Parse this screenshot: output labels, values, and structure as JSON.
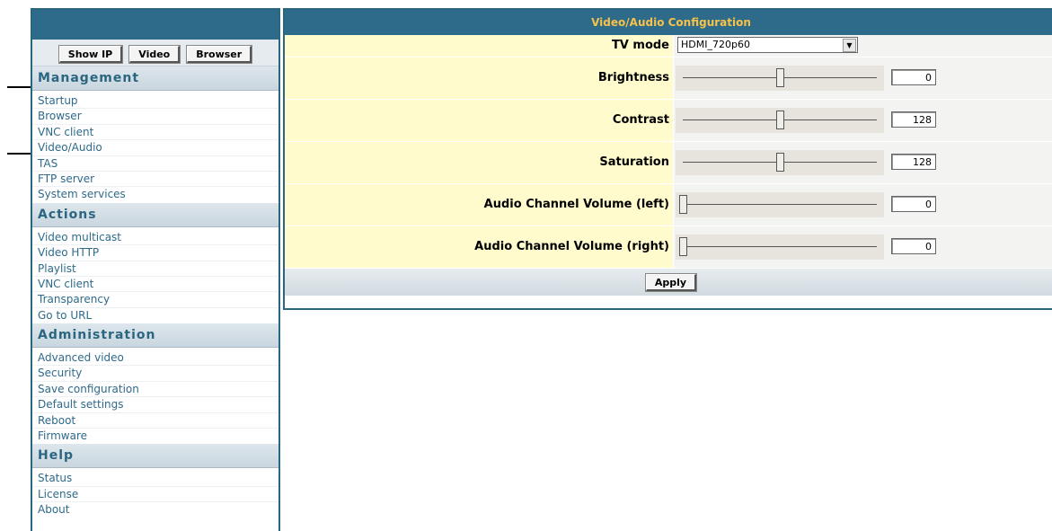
{
  "sidebar": {
    "buttons": [
      "Show IP",
      "Video",
      "Browser"
    ],
    "sections": [
      {
        "title": "Management",
        "items": [
          "Startup",
          "Browser",
          "VNC client",
          "Video/Audio",
          "TAS",
          "FTP server",
          "System services"
        ]
      },
      {
        "title": "Actions",
        "items": [
          "Video multicast",
          "Video HTTP",
          "Playlist",
          "VNC client",
          "Transparency",
          "Go to URL"
        ]
      },
      {
        "title": "Administration",
        "items": [
          "Advanced video",
          "Security",
          "Save configuration",
          "Default settings",
          "Reboot",
          "Firmware"
        ]
      },
      {
        "title": "Help",
        "items": [
          "Status",
          "License",
          "About"
        ]
      }
    ]
  },
  "panel": {
    "title": "Video/Audio Configuration",
    "tv_mode": {
      "label": "TV mode",
      "value": "HDMI_720p60"
    },
    "sliders": [
      {
        "name": "brightness",
        "label": "Brightness",
        "value": "0",
        "position": 0.5
      },
      {
        "name": "contrast",
        "label": "Contrast",
        "value": "128",
        "position": 0.5
      },
      {
        "name": "saturation",
        "label": "Saturation",
        "value": "128",
        "position": 0.5
      },
      {
        "name": "audio-left",
        "label": "Audio Channel Volume (left)",
        "value": "0",
        "position": 0
      },
      {
        "name": "audio-right",
        "label": "Audio Channel Volume (right)",
        "value": "0",
        "position": 0
      }
    ],
    "apply_label": "Apply"
  },
  "colors": {
    "header": "#2e6a8a",
    "title_text": "#f5c24a",
    "label_bg": "#fffbcc",
    "link": "#2e6a8a"
  }
}
